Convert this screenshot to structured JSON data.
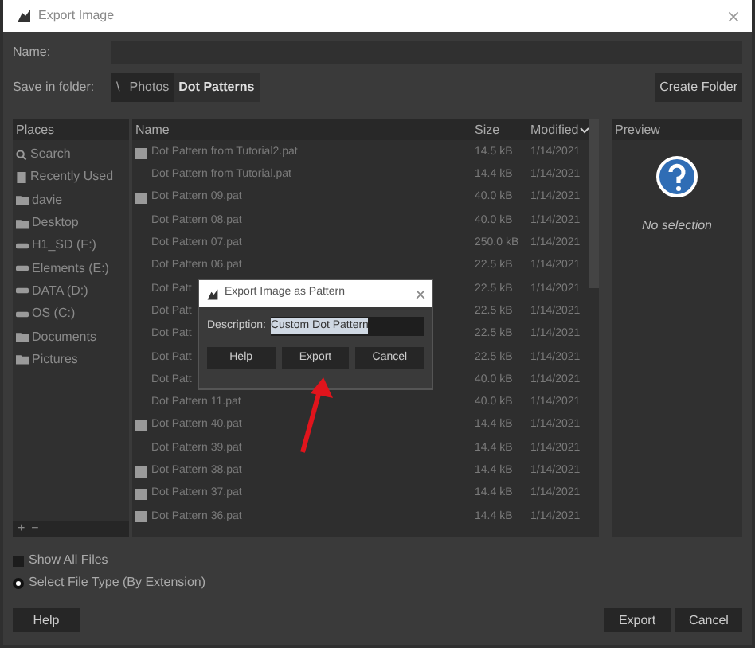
{
  "window": {
    "title": "Export Image"
  },
  "name_label": "Name:",
  "folder_label": "Save in folder:",
  "breadcrumb": [
    {
      "label": "\\",
      "selected": false
    },
    {
      "label": "Photos",
      "selected": false
    },
    {
      "label": "Dot Patterns",
      "selected": true
    }
  ],
  "create_folder": "Create Folder",
  "places": {
    "header": "Places",
    "items": [
      {
        "label": "Search",
        "kind": "search"
      },
      {
        "label": "Recently Used",
        "kind": "recent"
      },
      {
        "label": "davie",
        "kind": "folder"
      },
      {
        "label": "Desktop",
        "kind": "folder"
      },
      {
        "label": "H1_SD (F:)",
        "kind": "drive"
      },
      {
        "label": "Elements (E:)",
        "kind": "drive"
      },
      {
        "label": "DATA (D:)",
        "kind": "drive"
      },
      {
        "label": "OS (C:)",
        "kind": "drive"
      },
      {
        "label": "Documents",
        "kind": "folder"
      },
      {
        "label": "Pictures",
        "kind": "folder"
      }
    ],
    "add": "+",
    "remove": "−"
  },
  "files": {
    "columns": [
      {
        "label": "Name",
        "sorted": false
      },
      {
        "label": "Size",
        "sorted": false
      },
      {
        "label": "Modified",
        "sorted": true
      }
    ],
    "rows": [
      {
        "name": "Dot Pattern from Tutorial2.pat",
        "size": "14.5 kB",
        "modified": "1/14/2021",
        "icon": true
      },
      {
        "name": "Dot Pattern from Tutorial.pat",
        "size": "14.4 kB",
        "modified": "1/14/2021",
        "icon": false
      },
      {
        "name": "Dot Pattern 09.pat",
        "size": "40.0 kB",
        "modified": "1/14/2021",
        "icon": true
      },
      {
        "name": "Dot Pattern 08.pat",
        "size": "40.0 kB",
        "modified": "1/14/2021",
        "icon": false
      },
      {
        "name": "Dot Pattern 07.pat",
        "size": "250.0 kB",
        "modified": "1/14/2021",
        "icon": false
      },
      {
        "name": "Dot Pattern 06.pat",
        "size": "22.5 kB",
        "modified": "1/14/2021",
        "icon": false
      },
      {
        "name": "Dot Patt",
        "size": "22.5 kB",
        "modified": "1/14/2021",
        "icon": false
      },
      {
        "name": "Dot Patt",
        "size": "22.5 kB",
        "modified": "1/14/2021",
        "icon": false
      },
      {
        "name": "Dot Patt",
        "size": "22.5 kB",
        "modified": "1/14/2021",
        "icon": false
      },
      {
        "name": "Dot Patt",
        "size": "22.5 kB",
        "modified": "1/14/2021",
        "icon": false
      },
      {
        "name": "Dot Patt",
        "size": "40.0 kB",
        "modified": "1/14/2021",
        "icon": false
      },
      {
        "name": "Dot Pattern 11.pat",
        "size": "40.0 kB",
        "modified": "1/14/2021",
        "icon": false
      },
      {
        "name": "Dot Pattern 40.pat",
        "size": "14.4 kB",
        "modified": "1/14/2021",
        "icon": true
      },
      {
        "name": "Dot Pattern 39.pat",
        "size": "14.4 kB",
        "modified": "1/14/2021",
        "icon": false
      },
      {
        "name": "Dot Pattern 38.pat",
        "size": "14.4 kB",
        "modified": "1/14/2021",
        "icon": true
      },
      {
        "name": "Dot Pattern 37.pat",
        "size": "14.4 kB",
        "modified": "1/14/2021",
        "icon": true
      },
      {
        "name": "Dot Pattern 36.pat",
        "size": "14.4 kB",
        "modified": "1/14/2021",
        "icon": true
      }
    ]
  },
  "preview": {
    "header": "Preview",
    "message": "No selection"
  },
  "show_all_files": {
    "label": "Show All Files",
    "checked": false
  },
  "file_type": {
    "label": "Select File Type (By Extension)",
    "expanded": false
  },
  "buttons": {
    "help": "Help",
    "export": "Export",
    "cancel": "Cancel"
  },
  "dialog": {
    "title": "Export Image as Pattern",
    "description_label": "Description:",
    "description_value": "Custom Dot Pattern",
    "buttons": [
      "Help",
      "Export",
      "Cancel"
    ]
  }
}
